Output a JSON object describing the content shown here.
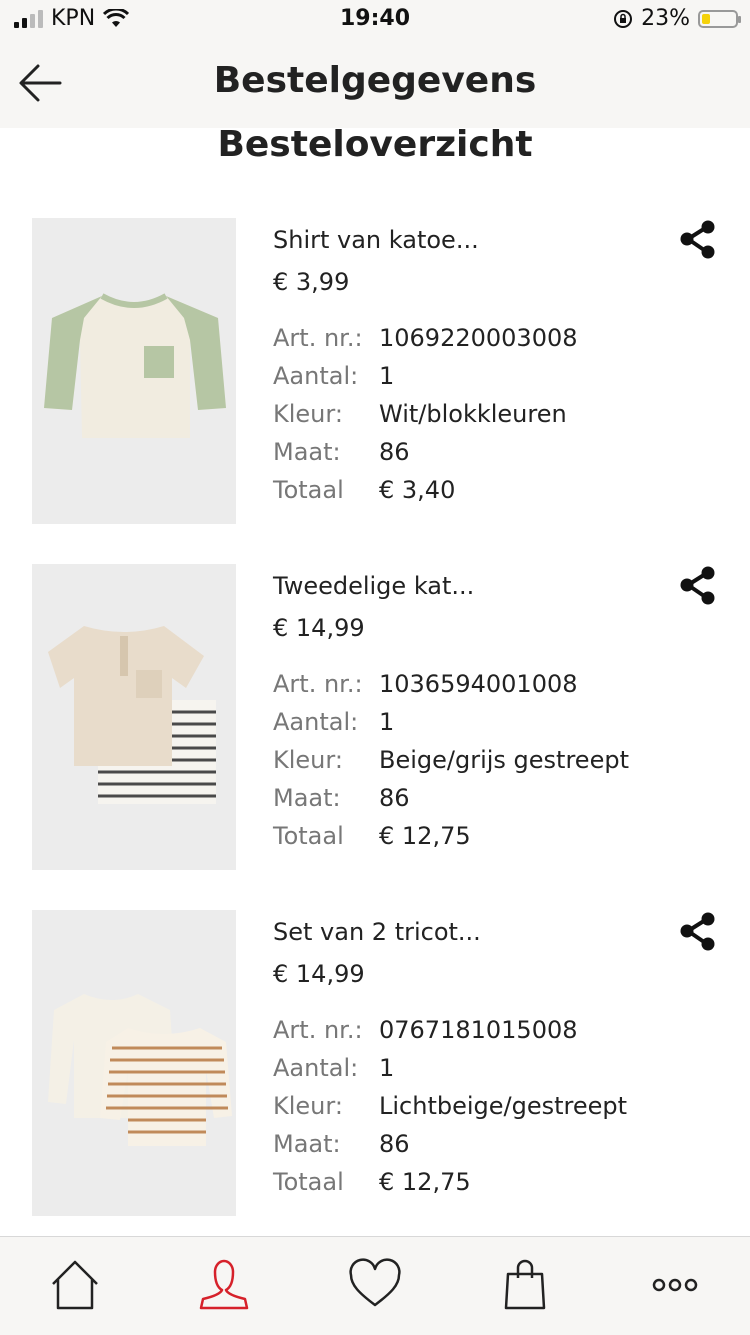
{
  "status_bar": {
    "carrier": "KPN",
    "time": "19:40",
    "battery": "23%",
    "battery_level": 0.23
  },
  "nav": {
    "title": "Bestelgegevens",
    "back_icon": "arrow-left-icon"
  },
  "section_title": "Besteloverzicht",
  "labels": {
    "art_nr": "Art. nr.:",
    "aantal": "Aantal:",
    "kleur": "Kleur:",
    "maat": "Maat:",
    "totaal": "Totaal"
  },
  "items": [
    {
      "name": "Shirt van katoe...",
      "price": "€ 3,99",
      "art_nr": "1069220003008",
      "aantal": "1",
      "kleur": "Wit/blokkleuren",
      "maat": "86",
      "totaal": "€ 3,40"
    },
    {
      "name": "Tweedelige kat...",
      "price": "€ 14,99",
      "art_nr": "1036594001008",
      "aantal": "1",
      "kleur": "Beige/grijs gestreept",
      "maat": "86",
      "totaal": "€ 12,75"
    },
    {
      "name": "Set van 2 tricot...",
      "price": "€ 14,99",
      "art_nr": "0767181015008",
      "aantal": "1",
      "kleur": "Lichtbeige/gestreept",
      "maat": "86",
      "totaal": "€ 12,75"
    }
  ],
  "tabs": [
    "home-icon",
    "account-icon",
    "heart-icon",
    "shopping-bag-icon",
    "more-icon"
  ],
  "colors": {
    "active_tab": "#d6212a",
    "bar_bg": "#f7f6f4",
    "label_gray": "#777777"
  }
}
